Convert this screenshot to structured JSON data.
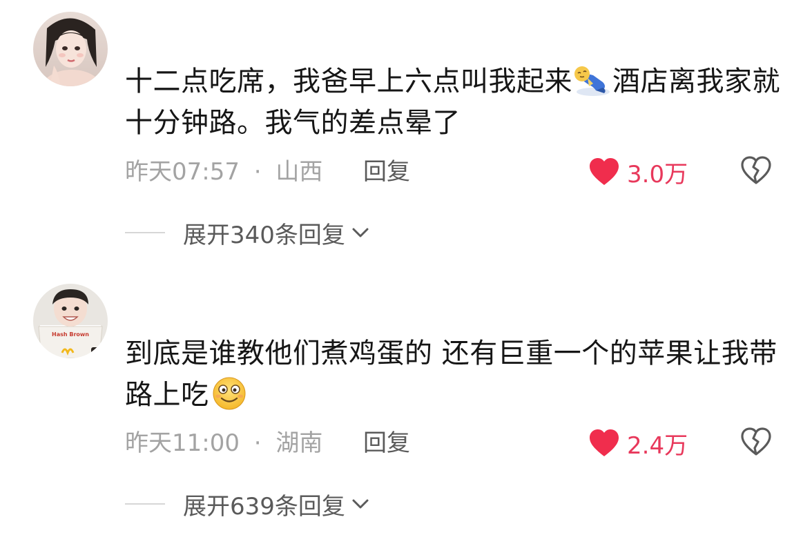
{
  "comments": [
    {
      "text_before_emoji": "十二点吃席，我爸早上六点叫我起来",
      "emoji": "lying-down-tired-emoji",
      "text_after_emoji": "酒店离我家就十分钟路。我气的差点晕了",
      "time": "昨天07:57",
      "separator": "·",
      "location": "山西",
      "reply_label": "回复",
      "like_count": "3.0万",
      "expand_label": "展开340条回复"
    },
    {
      "text_before_emoji": "到底是谁教他们煮鸡蛋的 还有巨重一个的苹果让我带路上吃",
      "emoji": "smiling-face-emoji",
      "text_after_emoji": "",
      "time": "昨天11:00",
      "separator": "·",
      "location": "湖南",
      "reply_label": "回复",
      "like_count": "2.4万",
      "expand_label": "展开639条回复"
    }
  ],
  "colors": {
    "text": "#161616",
    "meta": "#a3a3a3",
    "like": "#e8385b",
    "secondary": "#5a5a5a"
  }
}
